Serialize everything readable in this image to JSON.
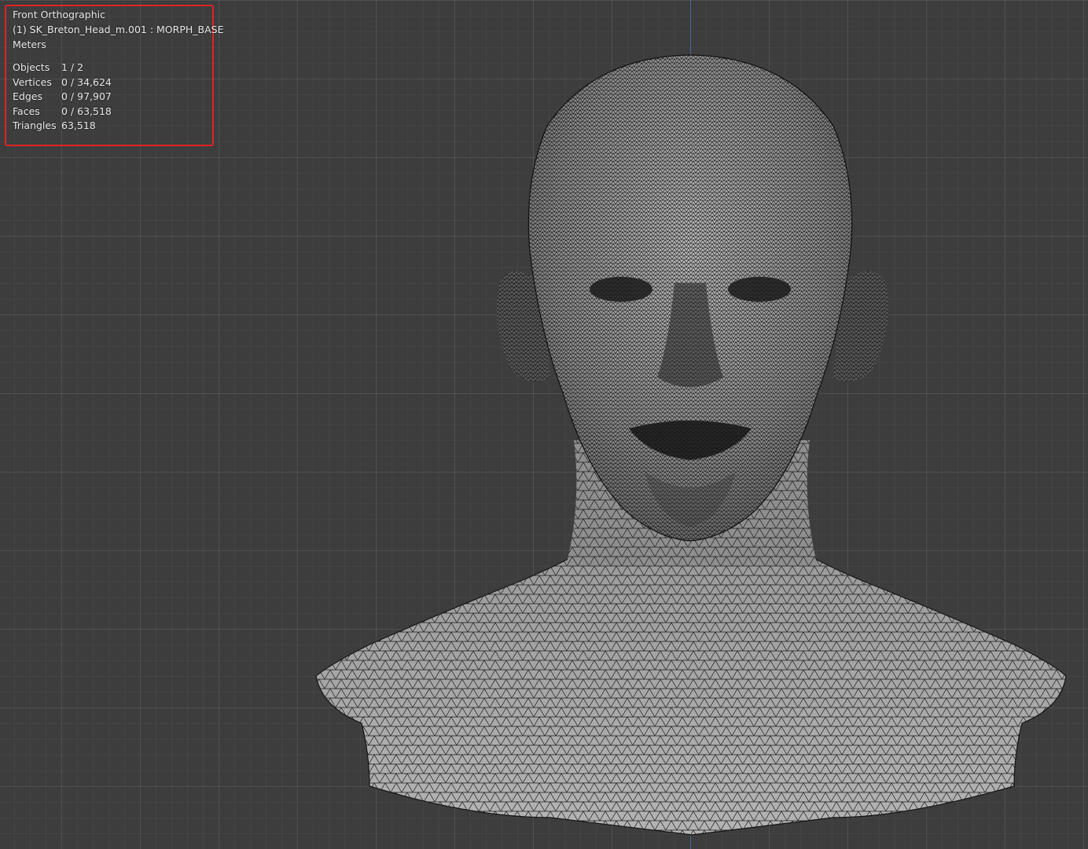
{
  "viewport": {
    "view_name": "Front Orthographic",
    "object_label": "(1) SK_Breton_Head_m.001 : MORPH_BASE",
    "units": "Meters",
    "stats": [
      {
        "label": "Objects",
        "value": "1 / 2"
      },
      {
        "label": "Vertices",
        "value": "0 / 34,624"
      },
      {
        "label": "Edges",
        "value": "0 / 97,907"
      },
      {
        "label": "Faces",
        "value": "0 / 63,518"
      },
      {
        "label": "Triangles",
        "value": "63,518"
      }
    ]
  },
  "colors": {
    "background": "#3d3d3d",
    "highlight_box": "#e02424",
    "y_axis": "#3f6fae",
    "mesh_fill": "#a8a8a8"
  }
}
